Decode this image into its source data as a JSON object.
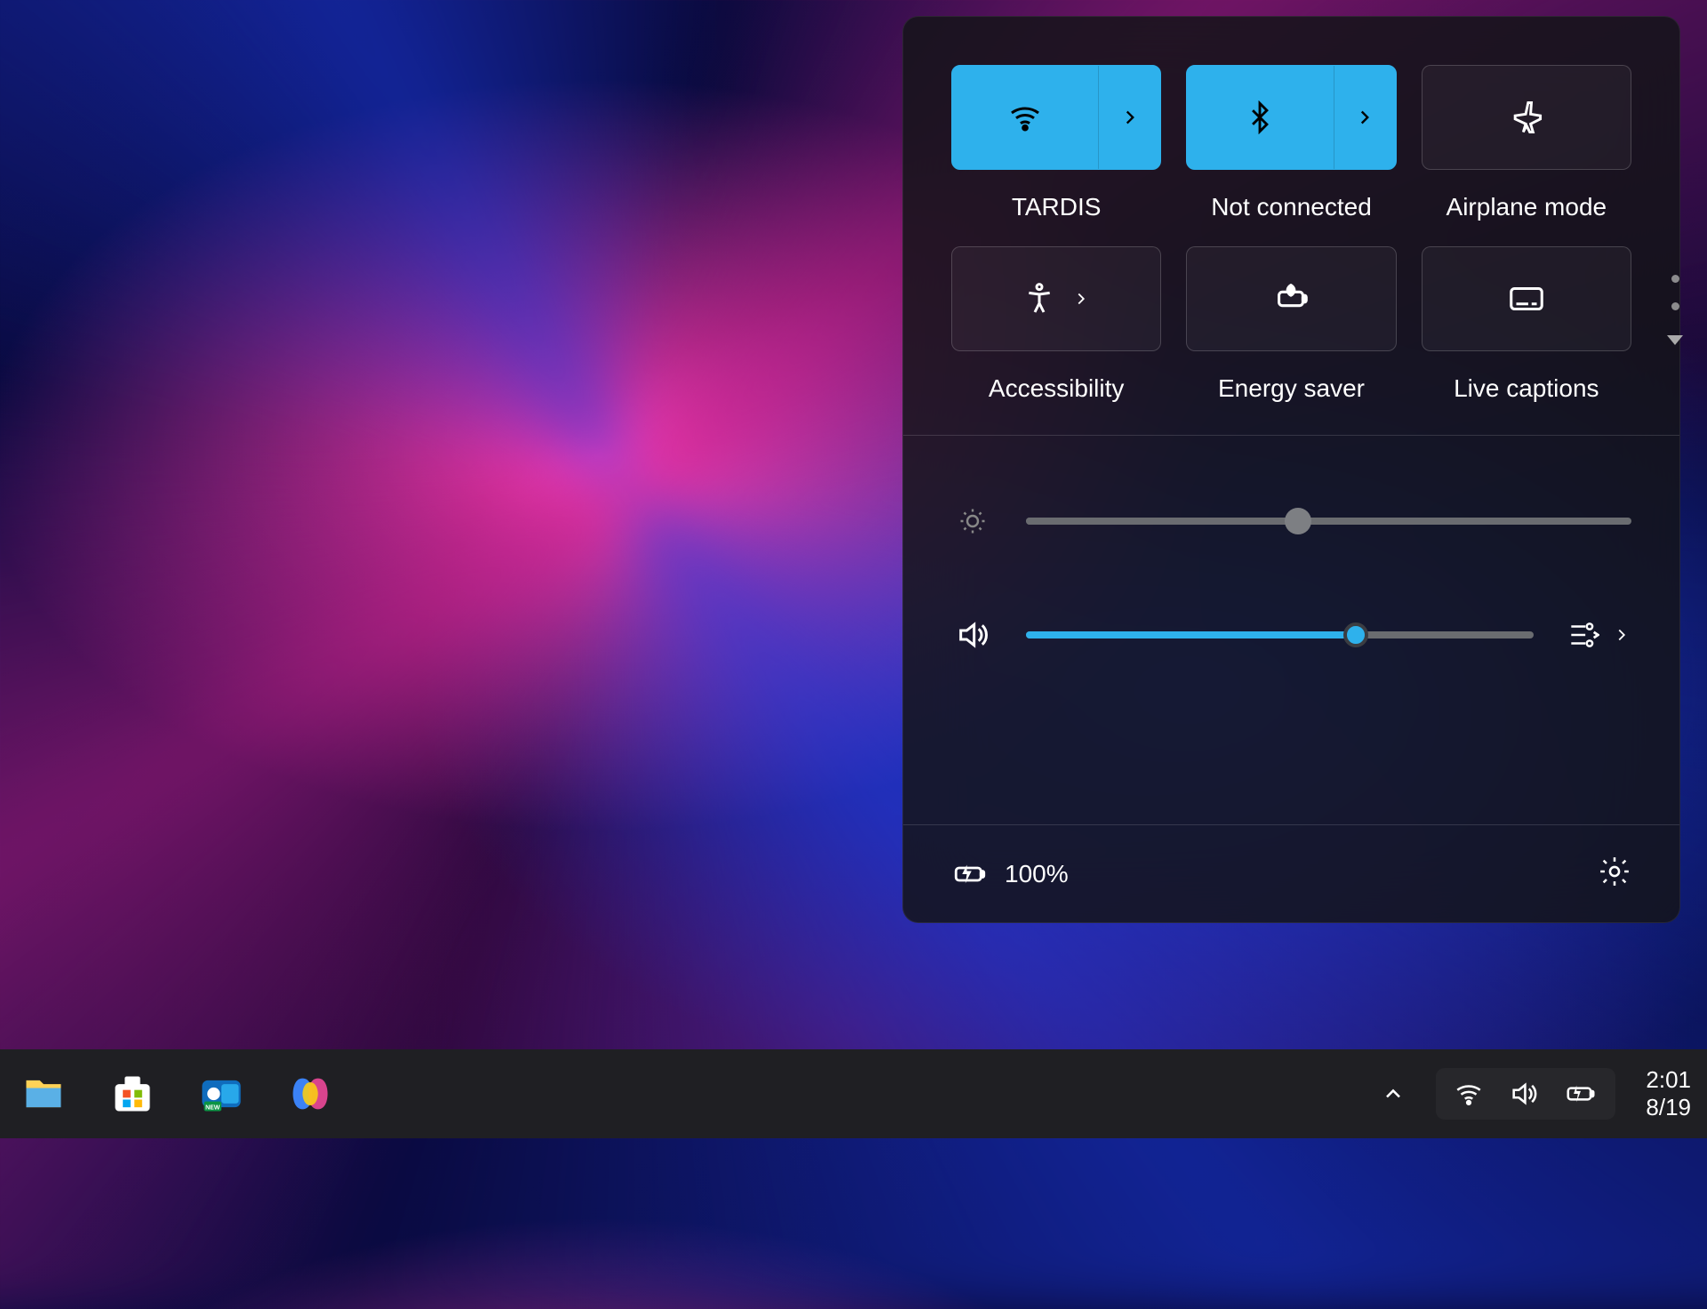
{
  "quick_settings": {
    "tiles": [
      {
        "name": "wifi",
        "label": "TARDIS",
        "active": true,
        "split": true
      },
      {
        "name": "bluetooth",
        "label": "Not connected",
        "active": true,
        "split": true
      },
      {
        "name": "airplane",
        "label": "Airplane mode",
        "active": false,
        "split": false
      },
      {
        "name": "accessibility",
        "label": "Accessibility",
        "active": false,
        "split": "small"
      },
      {
        "name": "energy-saver",
        "label": "Energy saver",
        "active": false,
        "split": false
      },
      {
        "name": "live-captions",
        "label": "Live captions",
        "active": false,
        "split": false
      }
    ],
    "brightness_percent": 45,
    "volume_percent": 65,
    "battery_label": "100%"
  },
  "taskbar": {
    "apps": [
      "file-explorer",
      "microsoft-store",
      "outlook",
      "copilot"
    ],
    "clock_time": "2:01",
    "clock_date": "8/19"
  },
  "colors": {
    "accent": "#2eb1ec"
  }
}
